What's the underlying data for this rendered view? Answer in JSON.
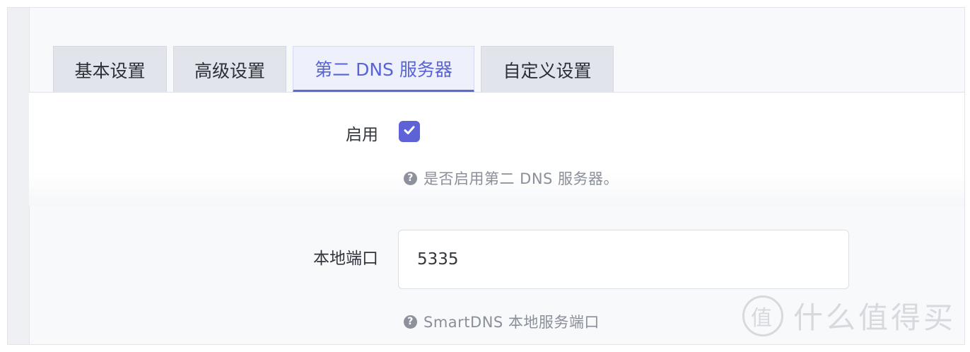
{
  "tabs": [
    {
      "label": "基本设置",
      "active": false
    },
    {
      "label": "高级设置",
      "active": false
    },
    {
      "label": "第二 DNS 服务器",
      "active": true
    },
    {
      "label": "自定义设置",
      "active": false
    }
  ],
  "enable": {
    "label": "启用",
    "checked": true,
    "help": "是否启用第二 DNS 服务器。"
  },
  "local_port": {
    "label": "本地端口",
    "value": "5335",
    "help": "SmartDNS 本地服务端口"
  },
  "watermark": {
    "badge": "值",
    "text": "什么值得买"
  },
  "colors": {
    "accent": "#5d63d6",
    "tab_bg": "#e1e4ea",
    "help_text": "#8a8f99"
  },
  "icons": {
    "checkbox": "check-icon",
    "help": "question-circle-icon"
  }
}
